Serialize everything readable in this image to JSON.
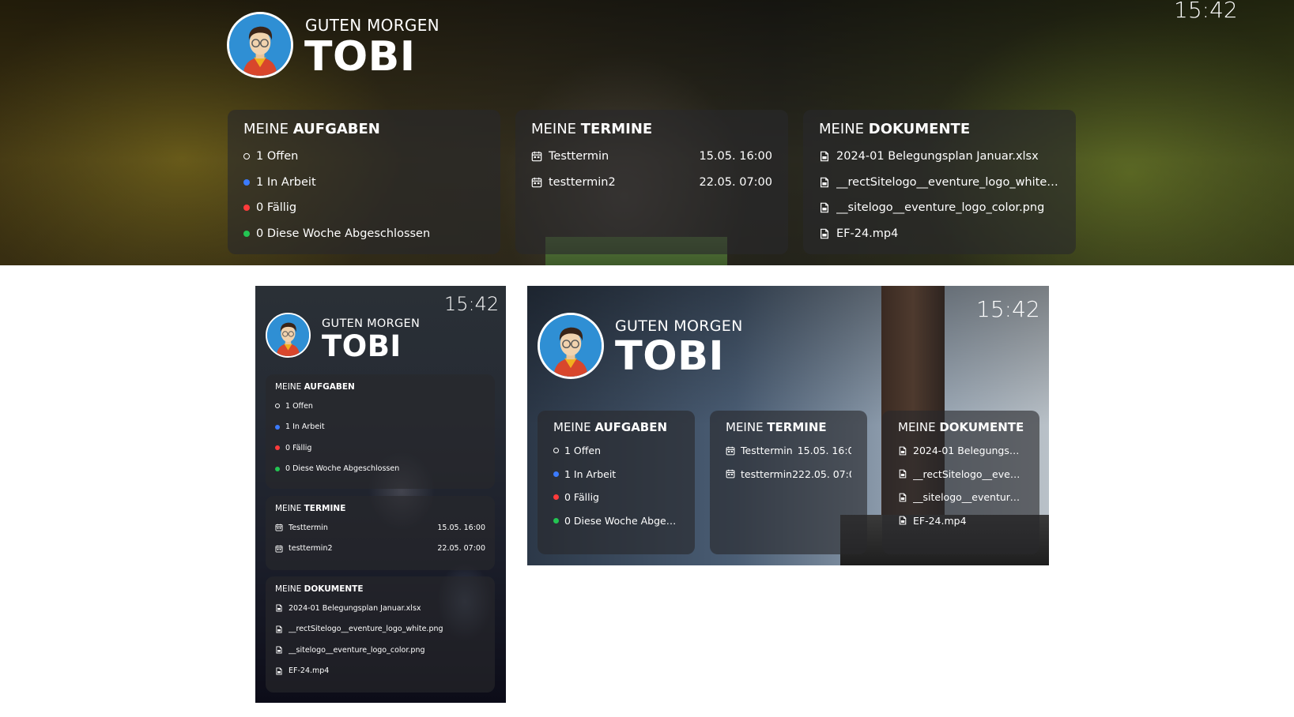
{
  "greeting": "GUTEN MORGEN",
  "name": "TOBI",
  "clock": "15:42",
  "titles": {
    "tasks_prefix": "MEINE ",
    "tasks_bold": "AUFGABEN",
    "appointments_prefix": "MEINE ",
    "appointments_bold": "TERMINE",
    "documents_prefix": "MEINE ",
    "documents_bold": "DOKUMENTE"
  },
  "tasks": [
    {
      "label": "1 Offen",
      "status": "open"
    },
    {
      "label": "1 In Arbeit",
      "status": "in-progress"
    },
    {
      "label": "0 Fällig",
      "status": "due"
    },
    {
      "label": "0 Diese Woche Abgeschlossen",
      "status": "done"
    }
  ],
  "tasks_truncated": [
    "1 Offen",
    "1 In Arbeit",
    "0 Fällig",
    "0 Diese Woche Abgesc..."
  ],
  "appointments": [
    {
      "title": "Testtermin",
      "date": "15.05. 16:00"
    },
    {
      "title": "testtermin2",
      "date": "22.05. 07:00"
    }
  ],
  "documents": [
    "2024-01 Belegungsplan Januar.xlsx",
    "__rectSitelogo__eventure_logo_white.png",
    "__sitelogo__eventure_logo_color.png",
    "EF-24.mp4"
  ],
  "documents_truncated": [
    "2024-01 Belegungspl...",
    "__rectSitelogo__event...",
    "__sitelogo__eventure_...",
    "EF-24.mp4"
  ],
  "colors": {
    "status_open": "#ffffff",
    "status_in_progress": "#3b7bff",
    "status_due": "#ff3b3b",
    "status_done": "#23c552"
  },
  "icons": {
    "appointment": "calendar-icon",
    "document": "document-icon",
    "avatar": "avatar-illustration"
  }
}
